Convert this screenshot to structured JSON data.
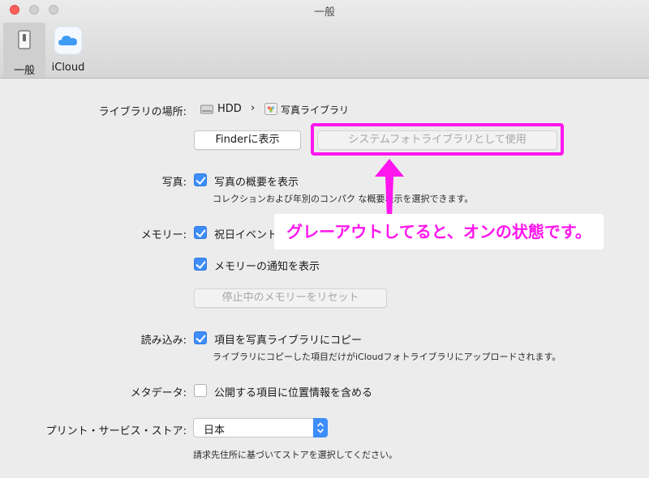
{
  "window": {
    "title": "一般"
  },
  "tabs": [
    {
      "label": "一般",
      "icon": "general-switch-icon",
      "selected": true
    },
    {
      "label": "iCloud",
      "icon": "icloud-icon",
      "selected": false
    }
  ],
  "library": {
    "label": "ライブラリの場所:",
    "drive": "HDD",
    "separator": "›",
    "library_name": "写真ライブラリ",
    "finder_button": "Finderに表示",
    "system_library_button": "システムフォトライブラリとして使用"
  },
  "photos": {
    "label": "写真:",
    "summary_label": "写真の概要を表示",
    "summary_checked": true,
    "summary_sub": "コレクションおよび年別のコンパク  な概要表示を選択できます。"
  },
  "memories": {
    "label": "メモリー:",
    "holiday_label": "祝日イベント",
    "holiday_checked": true,
    "notify_label": "メモリーの通知を表示",
    "notify_checked": true,
    "reset_button": "停止中のメモリーをリセット"
  },
  "importing": {
    "label": "読み込み:",
    "copy_label": "項目を写真ライブラリにコピー",
    "copy_checked": true,
    "copy_sub": "ライブラリにコピーした項目だけがiCloudフォトライブラリにアップロードされます。"
  },
  "metadata": {
    "label": "メタデータ:",
    "location_label": "公開する項目に位置情報を含める",
    "location_checked": false
  },
  "print_store": {
    "label": "プリント・サービス・ストア:",
    "selected": "日本",
    "sub": "請求先住所に基づいてストアを選択してください。"
  },
  "annotation": {
    "callout": "グレーアウトしてると、オンの状態です。",
    "color": "#ff16ee"
  },
  "colors": {
    "accent": "#3d8dfb",
    "close": "#fc605c"
  }
}
